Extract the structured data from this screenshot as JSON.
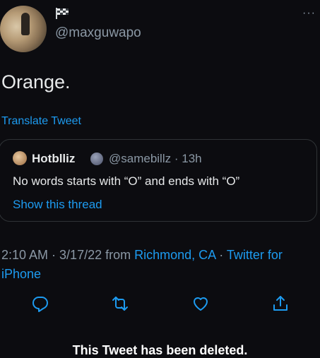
{
  "author": {
    "handle": "@maxguwapo",
    "more_label": "···"
  },
  "tweet": {
    "text": "Orange.",
    "translate_label": "Translate Tweet"
  },
  "quoted_tweet": {
    "name": "Hotblliz",
    "handle": "@samebillz",
    "separator": "·",
    "time": "13h",
    "text": "No words starts with “O” and ends with “O”",
    "show_thread_label": "Show this thread"
  },
  "meta": {
    "time": "2:10 AM",
    "sep1": " · ",
    "date": "3/17/22",
    "from": " from ",
    "location": "Richmond, CA",
    "sep2": " · ",
    "source": "Twitter for iPhone"
  },
  "actions": {
    "icons": [
      "reply-icon",
      "retweet-icon",
      "like-icon",
      "share-icon"
    ]
  },
  "caption": "This Tweet has been deleted.",
  "colors": {
    "background": "#0c0c10",
    "text": "#e7e9ea",
    "secondary": "#8b98a5",
    "accent": "#1d9bf0"
  }
}
